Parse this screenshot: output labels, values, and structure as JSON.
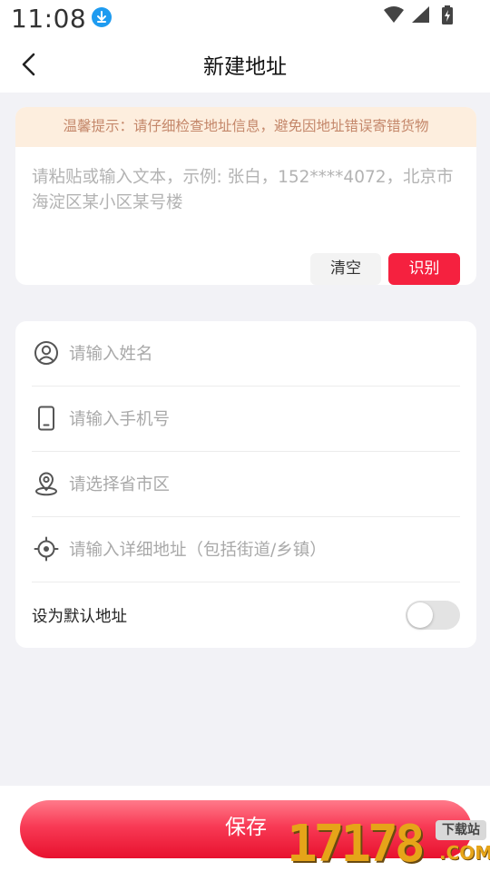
{
  "status_bar": {
    "time": "11:08"
  },
  "header": {
    "title": "新建地址",
    "back_icon": "chevron-left-icon"
  },
  "tip": {
    "text": "温馨提示：请仔细检查地址信息，避免因地址错误寄错货物"
  },
  "paste_box": {
    "placeholder": "请粘贴或输入文本，示例: 张白，152****4072，北京市海淀区某小区某号楼",
    "clear_label": "清空",
    "recognize_label": "识别"
  },
  "form": {
    "fields": [
      {
        "icon": "user-icon",
        "placeholder": "请输入姓名"
      },
      {
        "icon": "phone-icon",
        "placeholder": "请输入手机号"
      },
      {
        "icon": "location-pin-icon",
        "placeholder": "请选择省市区"
      },
      {
        "icon": "target-icon",
        "placeholder": "请输入详细地址（包括街道/乡镇）"
      }
    ],
    "default_label": "设为默认地址",
    "default_enabled": false
  },
  "footer": {
    "save_label": "保存"
  },
  "watermark": {
    "digits": "17178",
    "site_label": "下载站",
    "suffix": ".COM"
  },
  "colors": {
    "accent": "#f5213f",
    "tip_bg": "#fdeede",
    "tip_text": "#c4876a",
    "page_bg": "#f2f2f6"
  }
}
